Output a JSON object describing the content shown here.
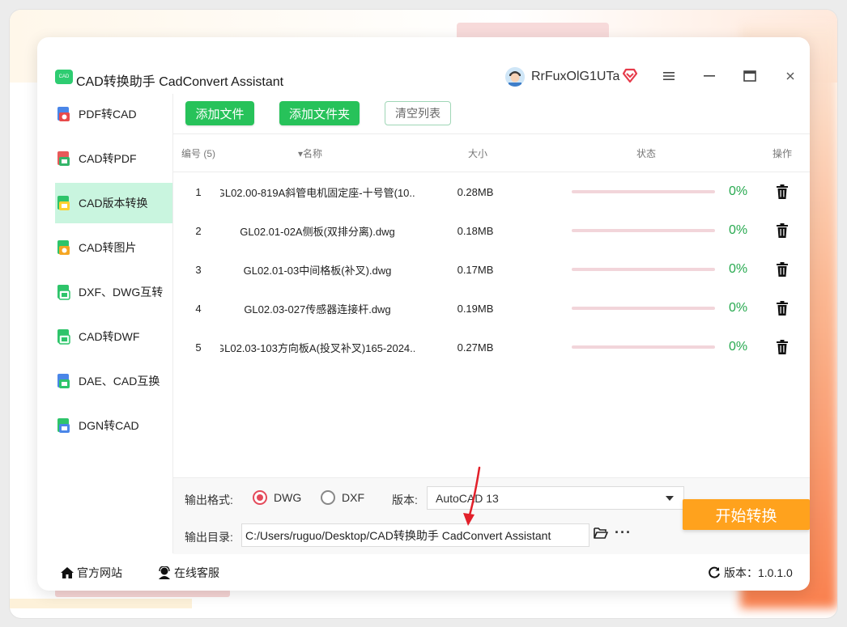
{
  "app": {
    "logo_text": "CAD",
    "title": "CAD转换助手 CadConvert Assistant",
    "username": "RrFuxOlG1UTa",
    "colors": {
      "accent_green": "#27c25a",
      "start_orange": "#ffa21d",
      "active_bg": "#c9f5df",
      "vip_red": "#e63a4a",
      "radio_red": "#e44a5a"
    }
  },
  "sidebar": {
    "items": [
      {
        "label": "PDF转CAD",
        "icon": "pdf-to-cad-icon"
      },
      {
        "label": "CAD转PDF",
        "icon": "cad-to-pdf-icon"
      },
      {
        "label": "CAD版本转换",
        "icon": "cad-version-icon",
        "active": true
      },
      {
        "label": "CAD转图片",
        "icon": "cad-to-image-icon"
      },
      {
        "label": "DXF、DWG互转",
        "icon": "dxf-dwg-icon"
      },
      {
        "label": "CAD转DWF",
        "icon": "cad-to-dwf-icon"
      },
      {
        "label": "DAE、CAD互换",
        "icon": "dae-cad-icon"
      },
      {
        "label": "DGN转CAD",
        "icon": "dgn-to-cad-icon"
      }
    ]
  },
  "toolbar": {
    "add_file": "添加文件",
    "add_folder": "添加文件夹",
    "clear_list": "清空列表"
  },
  "table": {
    "headers": {
      "index": "编号 (5)",
      "name": "▾名称",
      "size": "大小",
      "status": "状态",
      "action": "操作"
    },
    "rows": [
      {
        "index": "1",
        "name": "GL02.00-819A斜管电机固定座-十号管(10...",
        "size": "0.28MB",
        "progress": 0,
        "percent": "0%"
      },
      {
        "index": "2",
        "name": "GL02.01-02A侧板(双排分离).dwg",
        "size": "0.18MB",
        "progress": 0,
        "percent": "0%"
      },
      {
        "index": "3",
        "name": "GL02.01-03中间格板(补叉).dwg",
        "size": "0.17MB",
        "progress": 0,
        "percent": "0%"
      },
      {
        "index": "4",
        "name": "GL02.03-027传感器连接杆.dwg",
        "size": "0.19MB",
        "progress": 0,
        "percent": "0%"
      },
      {
        "index": "5",
        "name": "GL02.03-103方向板A(投叉补叉)165-2024...",
        "size": "0.27MB",
        "progress": 0,
        "percent": "0%"
      }
    ]
  },
  "output": {
    "format_label": "输出格式:",
    "options": [
      {
        "label": "DWG",
        "selected": true
      },
      {
        "label": "DXF",
        "selected": false
      }
    ],
    "version_label": "版本:",
    "version_value": "AutoCAD 13",
    "dir_label": "输出目录:",
    "dir_value": "C:/Users/ruguo/Desktop/CAD转换助手 CadConvert Assistant",
    "more": "···",
    "start": "开始转换"
  },
  "footer": {
    "website": "官方网站",
    "support": "在线客服",
    "version": "版本：1.0.1.0"
  }
}
